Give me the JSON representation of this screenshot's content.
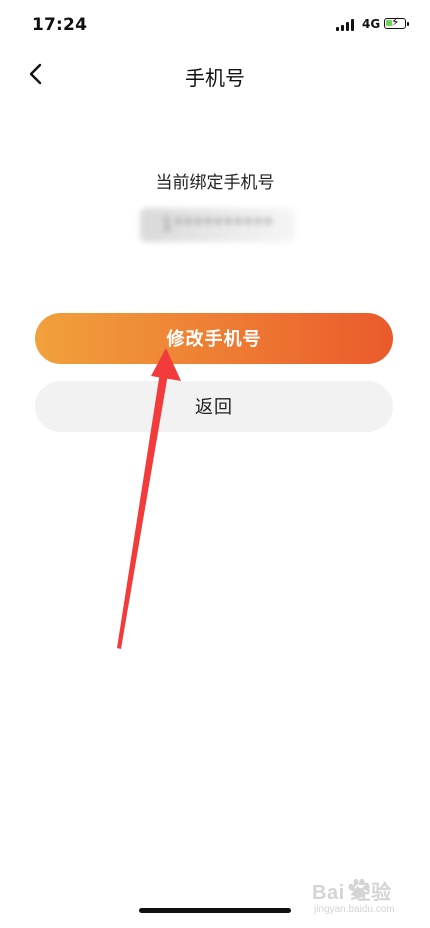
{
  "status_bar": {
    "time": "17:24",
    "network": "4G",
    "battery_level": 0.4,
    "signal_icon": "signal-bars-icon",
    "battery_icon": "battery-charging-icon"
  },
  "header": {
    "title": "手机号",
    "back_icon": "chevron-left-icon"
  },
  "phone_section": {
    "label": "当前绑定手机号",
    "number": "1**********"
  },
  "actions": {
    "change_label": "修改手机号",
    "back_label": "返回"
  },
  "watermark": {
    "brand": "Bai  经验",
    "url": "jingyan.baidu.com"
  },
  "colors": {
    "accent_start": "#f0a13c",
    "accent_end": "#ea5a2b",
    "annotation": "#f23b3b",
    "secondary_button": "#f2f2f2"
  }
}
